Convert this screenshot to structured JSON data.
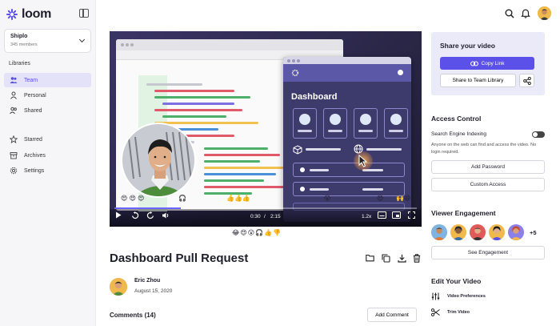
{
  "app": {
    "name": "loom"
  },
  "workspace": {
    "name": "Shiplo",
    "members": "345 members"
  },
  "sidebar": {
    "section_label": "Libraries",
    "items": [
      {
        "label": "Team",
        "icon": "team-icon",
        "active": true
      },
      {
        "label": "Personal",
        "icon": "person-icon",
        "active": false
      },
      {
        "label": "Shared",
        "icon": "shared-icon",
        "active": false
      },
      {
        "label": "Starred",
        "icon": "star-icon",
        "active": false
      },
      {
        "label": "Archives",
        "icon": "archive-icon",
        "active": false
      },
      {
        "label": "Settings",
        "icon": "gear-icon",
        "active": false
      }
    ]
  },
  "player": {
    "dashboard_title": "Dashboard",
    "current_time": "0:30",
    "duration": "2:15",
    "speed": "1.2x",
    "progress": 0.22,
    "reactions": "😂😍😮🎧👍👎"
  },
  "video": {
    "title": "Dashboard Pull Request",
    "author": "Eric Zhou",
    "date": "August 15, 2020",
    "comments_label": "Comments (14)",
    "add_comment_label": "Add Comment"
  },
  "share": {
    "title": "Share your video",
    "copy_link_label": "Copy Link",
    "team_library_label": "Share to Team Library"
  },
  "access": {
    "title": "Access Control",
    "indexing_label": "Search Engine Indexing",
    "indexing_desc": "Anyone on the web can find and access the video. No login required.",
    "add_password_label": "Add Password",
    "custom_access_label": "Custom Access"
  },
  "engagement": {
    "title": "Viewer Engagement",
    "more_count": "+5",
    "see_label": "See Engagement"
  },
  "edit": {
    "title": "Edit Your Video",
    "prefs_label": "Video Preferences",
    "trim_label": "Trim Video"
  },
  "colors": {
    "accent": "#5b50e8",
    "active_nav_bg": "#e4e2f9",
    "share_bg": "#ebeaf8"
  }
}
